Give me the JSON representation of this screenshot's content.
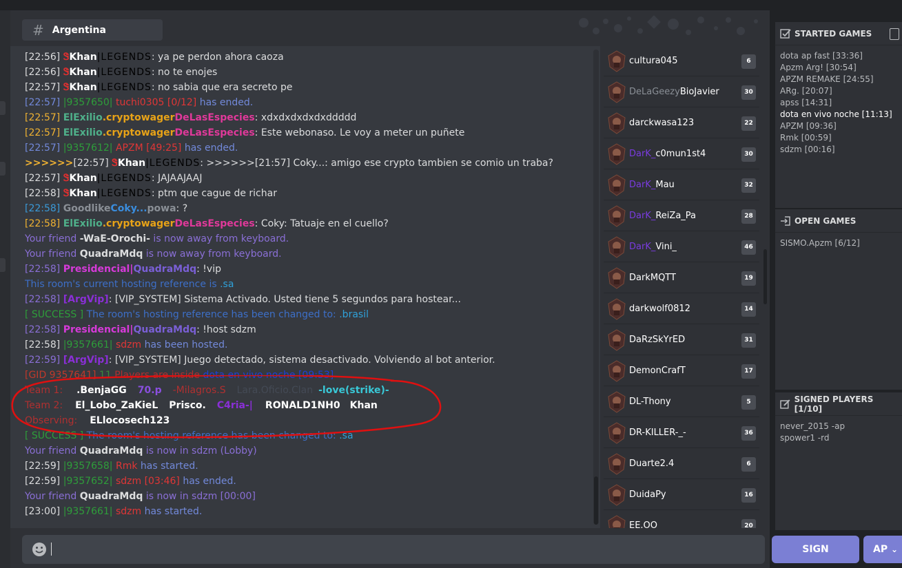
{
  "room": {
    "name": "Argentina"
  },
  "chat": [
    {
      "id": "l1",
      "ts": "[22:56] ",
      "mark": "Ꮥ",
      "user": "Khan",
      "suffix": "|LEGENDS",
      "text": ": ya pe perdon ahora caoza"
    },
    {
      "id": "l2",
      "ts": "[22:56] ",
      "mark": "Ꮥ",
      "user": "Khan",
      "suffix": "|LEGENDS",
      "text": ": no te enojes"
    },
    {
      "id": "l3",
      "ts": "[22:57] ",
      "mark": "Ꮥ",
      "user": "Khan",
      "suffix": "|LEGENDS",
      "text": ": no sabia que era secreto pe"
    },
    {
      "id": "l4",
      "ts": "[22:57] ",
      "gid": "|9357650|",
      "game": " tuchi0305 [0/12]",
      "text": " has ended."
    },
    {
      "id": "l5",
      "ts": "[22:57] ",
      "p1": "ElExilio",
      "p2": ".cryptowager",
      "p3": "DeLasEspecies",
      "text": ": xdxdxdxdxdxddddd"
    },
    {
      "id": "l6",
      "ts": "[22:57] ",
      "p1": "ElExilio",
      "p2": ".cryptowager",
      "p3": "DeLasEspecies",
      "text": ": Este webonaso. Le voy a meter un puñete"
    },
    {
      "id": "l7",
      "ts": "[22:57] ",
      "gid": "|9357612|",
      "game": " APZM [49:25]",
      "text": " has ended."
    },
    {
      "id": "l8",
      "pre": ">>>>>>",
      "ts": "[22:57] ",
      "mark": "Ꮥ",
      "user": "Khan",
      "suffix": "|LEGENDS",
      "text": ": >>>>>>[21:57] Coky...: amigo ese crypto tambien se comio un traba?"
    },
    {
      "id": "l9",
      "ts": "[22:57] ",
      "mark": "Ꮥ",
      "user": "Khan",
      "suffix": "|LEGENDS",
      "text": ": JAJAAJAAJ"
    },
    {
      "id": "l10",
      "ts": "[22:58] ",
      "mark": "Ꮥ",
      "user": "Khan",
      "suffix": "|LEGENDS",
      "text": ": ptm que cague de richar"
    },
    {
      "id": "l11",
      "ts": "[22:58] ",
      "p1": "Goodlike",
      "p2": "Coky...",
      "p3": "powa",
      "text": ": ?"
    },
    {
      "id": "l12",
      "ts": "[22:58] ",
      "p1": "ElExilio",
      "p2": ".cryptowager",
      "p3": "DeLasEspecies",
      "text": ": Coky: Tatuaje en el cuello?"
    },
    {
      "id": "l13",
      "a": "Your friend ",
      "b": "-WaE-Orochi-",
      "c": " is now away from keyboard."
    },
    {
      "id": "l14",
      "a": "Your friend ",
      "b": "QuadraMdq",
      "c": " is now away from keyboard."
    },
    {
      "id": "l15",
      "ts": "[22:58] ",
      "p1": "Presidencial|",
      "p2": "QuadraMdq",
      "text": ": !vip"
    },
    {
      "id": "l16",
      "a": "This room's current hosting reference is ",
      "b": ".sa"
    },
    {
      "id": "l17",
      "ts": "[22:58] ",
      "p1": "[ArgVip]",
      "text": ": [VIP_SYSTEM] Sistema Activado. Usted tiene 5 segundos para hostear..."
    },
    {
      "id": "l18",
      "a": "[ SUCCESS ]",
      "b": " The room's hosting reference has been changed to: ",
      "c": ".brasil"
    },
    {
      "id": "l19",
      "ts": "[22:58] ",
      "p1": "Presidencial|",
      "p2": "QuadraMdq",
      "text": ": !host sdzm"
    },
    {
      "id": "l20",
      "ts": "[22:58] ",
      "gid": "|9357661|",
      "game": " sdzm",
      "text": " has been hosted."
    },
    {
      "id": "l21",
      "ts": "[22:59] ",
      "p1": "[ArgVip]",
      "text": ": [VIP_SYSTEM] Juego detectado, sistema desactivado. Volviendo al bot anterior."
    },
    {
      "id": "l22",
      "gid": "[GID 9357641]",
      "count": " 11 ",
      "players": "Players are inside",
      "game": " dota en vivo noche [09:53]"
    },
    {
      "id": "l23",
      "label": "Team 1:",
      "players": [
        ".BenjaGG",
        "70.p",
        "-Milagros.S",
        "Lara.Oficio.Clan",
        "-love(strike)-"
      ]
    },
    {
      "id": "l24",
      "label": "Team 2:",
      "players": [
        "El_Lobo_ZaKieL",
        "Prisco.",
        "C4ria-|",
        "RONALD1NH0",
        "Khan"
      ]
    },
    {
      "id": "l25",
      "label": "Observing:",
      "players": [
        "ELlocosech123"
      ]
    },
    {
      "id": "l26",
      "a": "[ SUCCESS ]",
      "b": " The room's hosting reference has been changed to: ",
      "c": ".sa"
    },
    {
      "id": "l27",
      "a": "Your friend ",
      "b": "QuadraMdq",
      "c": " is now in sdzm (Lobby)"
    },
    {
      "id": "l28",
      "ts": "[22:59] ",
      "gid": "|9357658|",
      "game": " Rmk",
      "text": " has started."
    },
    {
      "id": "l29",
      "ts": "[22:59] ",
      "gid": "|9357652|",
      "game": " sdzm [03:46]",
      "text": " has ended."
    },
    {
      "id": "l30",
      "a": "Your friend ",
      "b": "QuadraMdq",
      "c": " is now in sdzm [00:00]"
    },
    {
      "id": "l31",
      "ts": "[23:00] ",
      "gid": "|9357661|",
      "game": " sdzm",
      "text": " has started."
    }
  ],
  "users": [
    {
      "pre": "",
      "name": "cultura045",
      "badge": "6"
    },
    {
      "pre_grey": "DeLaGeezy",
      "name": "BioJavier",
      "badge": "30"
    },
    {
      "pre": "",
      "name": "darckwasa123",
      "badge": "22"
    },
    {
      "pre": "DarK_",
      "name": "c0mun1st4",
      "badge": "30"
    },
    {
      "pre": "DarK_",
      "name": "Mau",
      "badge": "32"
    },
    {
      "pre": "DarK_",
      "name": "ReiZa_Pa",
      "badge": "28"
    },
    {
      "pre": "DarK_",
      "name": "Vini_",
      "badge": "46"
    },
    {
      "pre": "",
      "name": "DarkMQTT",
      "badge": "19"
    },
    {
      "pre": "",
      "name": "darkwolf0812",
      "badge": "14"
    },
    {
      "pre": "",
      "name": "DaRzSkYrED",
      "badge": "31"
    },
    {
      "pre": "",
      "name": "DemonCrafT",
      "badge": "17"
    },
    {
      "pre": "",
      "name": "DL-Thony",
      "badge": "5"
    },
    {
      "pre": "",
      "name": "DR-KILLER-_-",
      "badge": "36"
    },
    {
      "pre": "",
      "name": "Duarte2.4",
      "badge": "6"
    },
    {
      "pre": "",
      "name": "DuidaPy",
      "badge": "16"
    },
    {
      "pre": "",
      "name": "EE.OO",
      "badge": "20"
    }
  ],
  "started_games": {
    "title": "STARTED GAMES",
    "items": [
      "dota ap fast [33:36]",
      "Apzm Arg! [30:54]",
      "APZM REMAKE [24:55]",
      "ARg. [20:07]",
      "apss [14:31]",
      "dota en vivo noche [11:13]",
      "APZM [09:36]",
      "Rmk [00:59]",
      "sdzm [00:16]"
    ],
    "highlight_index": 5
  },
  "open_games": {
    "title": "OPEN GAMES",
    "items": [
      "SISMO.Apzm [6/12]"
    ]
  },
  "signed_players": {
    "title": "SIGNED PLAYERS [1/10]",
    "items": [
      "never_2015 -ap",
      "spower1 -rd"
    ]
  },
  "buttons": {
    "sign": "SIGN",
    "mode": "AP"
  },
  "colors": {
    "accent": "#7b7fd4",
    "annotation": "#e01010"
  },
  "icons": [
    "hash-icon",
    "checkbox-icon",
    "login-icon",
    "edit-icon",
    "emoji-icon",
    "hourglass-icon",
    "chevron-down-icon",
    "avatar-icon"
  ]
}
